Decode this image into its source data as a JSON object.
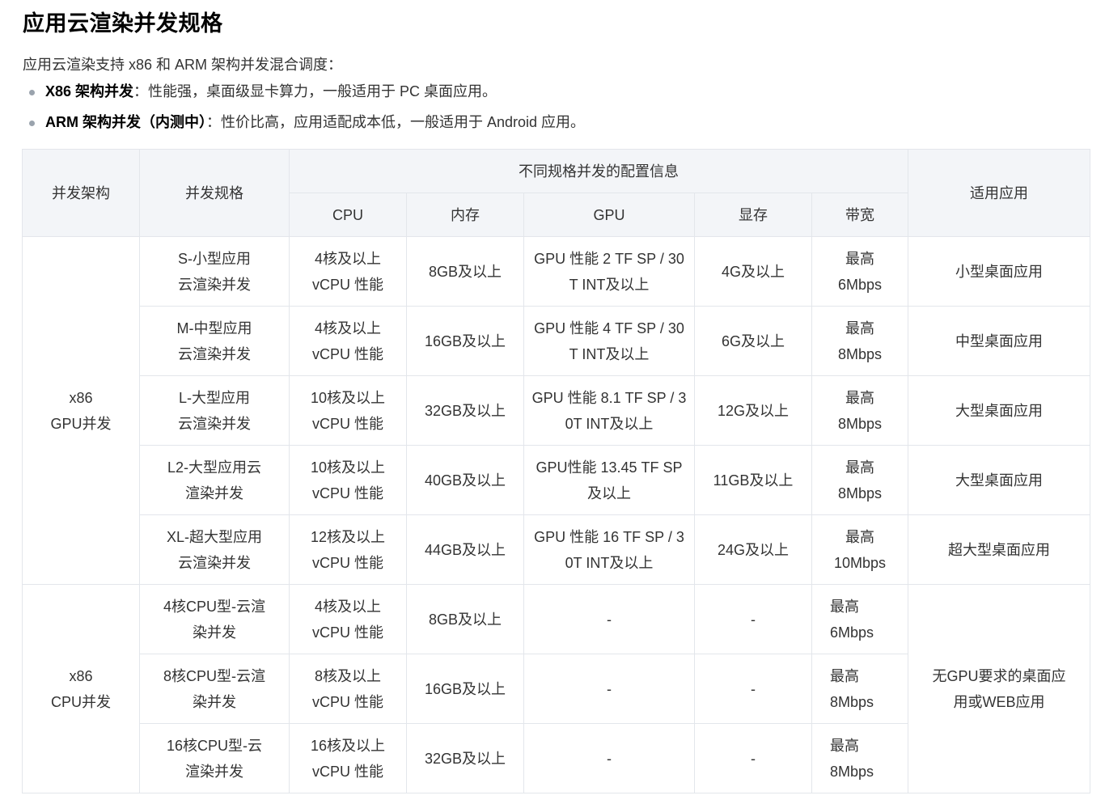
{
  "title": "应用云渲染并发规格",
  "intro": "应用云渲染支持 x86 和 ARM 架构并发混合调度：",
  "bullets": [
    {
      "label": "X86 架构并发",
      "text": "：性能强，桌面级显卡算力，一般适用于 PC 桌面应用。"
    },
    {
      "label": "ARM 架构并发（内测中）",
      "text": "：性价比高，应用适配成本低，一般适用于 Android 应用。"
    }
  ],
  "table": {
    "headers": {
      "arch": "并发架构",
      "spec": "并发规格",
      "config_group": "不同规格并发的配置信息",
      "cpu": "CPU",
      "memory": "内存",
      "gpu": "GPU",
      "vram": "显存",
      "bandwidth": "带宽",
      "app": "适用应用"
    },
    "groups": [
      {
        "arch_line1": "x86",
        "arch_line2": "GPU并发"
      },
      {
        "arch_line1": "x86",
        "arch_line2": "CPU并发"
      }
    ],
    "cpu_group_app": "无GPU要求的桌面应用或WEB应用",
    "rows": [
      {
        "spec_line1": "S-小型应用",
        "spec_line2": "云渲染并发",
        "cpu_line1": "4核及以上",
        "cpu_line2": "vCPU 性能",
        "memory": "8GB及以上",
        "gpu": "GPU 性能 2 TF SP / 30T INT及以上",
        "vram": "4G及以上",
        "bw_line1": "最高",
        "bw_line2": "6Mbps",
        "app": "小型桌面应用"
      },
      {
        "spec_line1": "M-中型应用",
        "spec_line2": "云渲染并发",
        "cpu_line1": "4核及以上",
        "cpu_line2": "vCPU 性能",
        "memory": "16GB及以上",
        "gpu": "GPU 性能 4 TF SP / 30T INT及以上",
        "vram": "6G及以上",
        "bw_line1": "最高",
        "bw_line2": "8Mbps",
        "app": "中型桌面应用"
      },
      {
        "spec_line1": "L-大型应用",
        "spec_line2": "云渲染并发",
        "cpu_line1": "10核及以上",
        "cpu_line2": "vCPU 性能",
        "memory": "32GB及以上",
        "gpu": "GPU 性能 8.1 TF SP / 30T INT及以上",
        "vram": "12G及以上",
        "bw_line1": "最高",
        "bw_line2": "8Mbps",
        "app": "大型桌面应用"
      },
      {
        "spec_line1": "L2-大型应用云",
        "spec_line2": "渲染并发",
        "cpu_line1": "10核及以上",
        "cpu_line2": "vCPU 性能",
        "memory": "40GB及以上",
        "gpu": "GPU性能 13.45 TF SP 及以上",
        "vram": "11GB及以上",
        "bw_line1": "最高",
        "bw_line2": "8Mbps",
        "app": "大型桌面应用"
      },
      {
        "spec_line1": "XL-超大型应用",
        "spec_line2": "云渲染并发",
        "cpu_line1": "12核及以上",
        "cpu_line2": "vCPU 性能",
        "memory": "44GB及以上",
        "gpu": "GPU 性能 16 TF SP / 30T INT及以上",
        "vram": "24G及以上",
        "bw_line1": "最高",
        "bw_line2": "10Mbps",
        "app": "超大型桌面应用"
      },
      {
        "spec_line1": "4核CPU型-云渲",
        "spec_line2": "染并发",
        "cpu_line1": "4核及以上",
        "cpu_line2": "vCPU 性能",
        "memory": "8GB及以上",
        "gpu": "-",
        "vram": "-",
        "bw_line1": "最高",
        "bw_line2": "6Mbps"
      },
      {
        "spec_line1": "8核CPU型-云渲",
        "spec_line2": "染并发",
        "cpu_line1": "8核及以上",
        "cpu_line2": "vCPU 性能",
        "memory": "16GB及以上",
        "gpu": "-",
        "vram": "-",
        "bw_line1": "最高",
        "bw_line2": "8Mbps"
      },
      {
        "spec_line1": "16核CPU型-云",
        "spec_line2": "渲染并发",
        "cpu_line1": "16核及以上",
        "cpu_line2": "vCPU 性能",
        "memory": "32GB及以上",
        "gpu": "-",
        "vram": "-",
        "bw_line1": "最高",
        "bw_line2": "8Mbps"
      }
    ]
  }
}
